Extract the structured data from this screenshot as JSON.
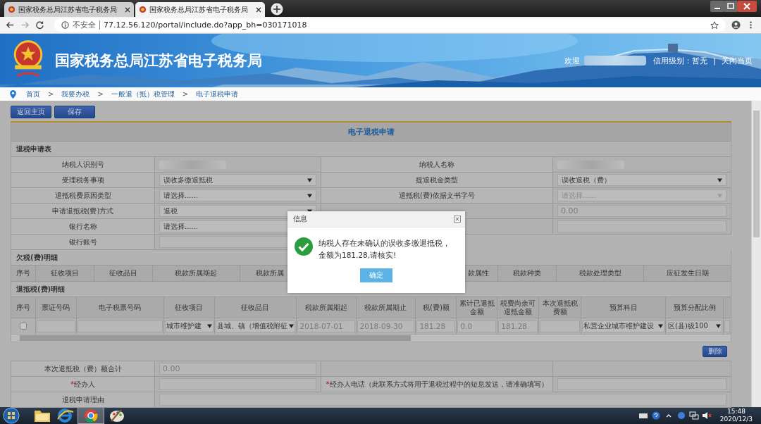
{
  "browser": {
    "tabs": [
      {
        "title": "国家税务总局江苏省电子税务局",
        "selected": false
      },
      {
        "title": "国家税务总局江苏省电子税务局",
        "selected": true
      }
    ],
    "address": {
      "security": "不安全",
      "url": "77.12.56.120/portal/include.do?app_bh=030171018"
    }
  },
  "banner": {
    "title": "国家税务总局江苏省电子税务局",
    "welcome": "欢迎",
    "credit": "信用级别：暂无",
    "separator": "|",
    "close": "关闭当页"
  },
  "breadcrumb": {
    "separator": ">",
    "items": [
      "首页",
      "我要办税",
      "一般退（抵）税管理",
      "电子退税申请"
    ]
  },
  "toolbar": [
    "返回主页",
    "保存"
  ],
  "form": {
    "title": "电子退税申请",
    "section": "退税申请表",
    "rows": [
      [
        {
          "kind": "label",
          "text": "纳税人识别号"
        },
        {
          "kind": "blurred"
        },
        {
          "kind": "label",
          "text": "纳税人名称"
        },
        {
          "kind": "blurred"
        }
      ],
      [
        {
          "kind": "label",
          "text": "受理税务事项"
        },
        {
          "kind": "select",
          "text": "误收多缴退抵税",
          "disabled": false
        },
        {
          "kind": "label",
          "text": "提退税金类型"
        },
        {
          "kind": "select",
          "text": "误收退税（费）",
          "disabled": false
        }
      ],
      [
        {
          "kind": "label",
          "text": "退抵税费原因类型"
        },
        {
          "kind": "select",
          "text": "请选择......",
          "disabled": false
        },
        {
          "kind": "label",
          "text": "退抵税(费)依据文书字号"
        },
        {
          "kind": "select",
          "text": "请选择......",
          "disabled": true
        }
      ],
      [
        {
          "kind": "label",
          "text": "申请退抵税(费)方式"
        },
        {
          "kind": "select",
          "text": "退税",
          "disabled": false
        },
        {
          "kind": "empty"
        },
        {
          "kind": "input",
          "value": "0.00"
        }
      ],
      [
        {
          "kind": "label",
          "text": "银行名称"
        },
        {
          "kind": "covered-select",
          "text": "请选择......",
          "disabled": false
        },
        {
          "kind": "empty"
        },
        {
          "kind": "input"
        }
      ],
      [
        {
          "kind": "label",
          "text": "银行账号"
        },
        {
          "kind": "input"
        },
        {
          "kind": "none"
        },
        {
          "kind": "none"
        }
      ]
    ]
  },
  "arrears": {
    "title": "欠税(费)明细",
    "columns": [
      "序号",
      "征收项目",
      "征收品目",
      "税款所属期起",
      "税款所属",
      "款属性",
      "税款种类",
      "税款处理类型",
      "应征发生日期"
    ]
  },
  "refunds": {
    "title": "退抵税(费)明细",
    "columns": [
      "序号",
      "票证号码",
      "电子税票号码",
      "征收项目",
      "征收品目",
      "税款所属期起",
      "税款所属期止",
      "税(费)额",
      "累计已退抵金额",
      "税费尚余可退抵金额",
      "本次退抵税费额",
      "预算科目",
      "预算分配比例"
    ],
    "rows": [
      [
        {
          "kind": "checkbox",
          "checked": false
        },
        {
          "kind": "input"
        },
        {
          "kind": "input"
        },
        {
          "kind": "select",
          "text": "城市维护建"
        },
        {
          "kind": "select",
          "text": "县城、镇（增值税附征"
        },
        {
          "kind": "input",
          "value": "2018-07-01"
        },
        {
          "kind": "input",
          "value": "2018-09-30"
        },
        {
          "kind": "input",
          "value": "181.28"
        },
        {
          "kind": "input",
          "value": "0.0"
        },
        {
          "kind": "input",
          "value": "181.28"
        },
        {
          "kind": "input"
        },
        {
          "kind": "select",
          "text": "私营企业城市维护建设"
        },
        {
          "kind": "select",
          "text": "区(县)级100"
        },
        {
          "kind": "input"
        }
      ]
    ]
  },
  "delete_button": "删除",
  "summary": {
    "rows": [
      [
        {
          "kind": "label",
          "text": "本次退抵税（费）额合计"
        },
        {
          "kind": "input",
          "value": "0.00"
        },
        {
          "kind": "empty"
        },
        {
          "kind": "empty"
        }
      ],
      [
        {
          "kind": "label",
          "mark": "*",
          "text": "经办人"
        },
        {
          "kind": "input"
        },
        {
          "kind": "label",
          "mark": "*",
          "text": "经办人电话（此联系方式将用于退税过程中的短息发送，请准确填写）"
        },
        {
          "kind": "input"
        }
      ],
      [
        {
          "kind": "label",
          "text": "退税申请理由"
        },
        {
          "kind": "wide-input"
        }
      ]
    ]
  },
  "dialog": {
    "title": "信息",
    "message": "纳税人存在未确认的误收多缴退抵税，金额为181.28,请核实!",
    "button": "确定"
  },
  "taskbar": {
    "time": "15:48",
    "date": "2020/12/3"
  }
}
